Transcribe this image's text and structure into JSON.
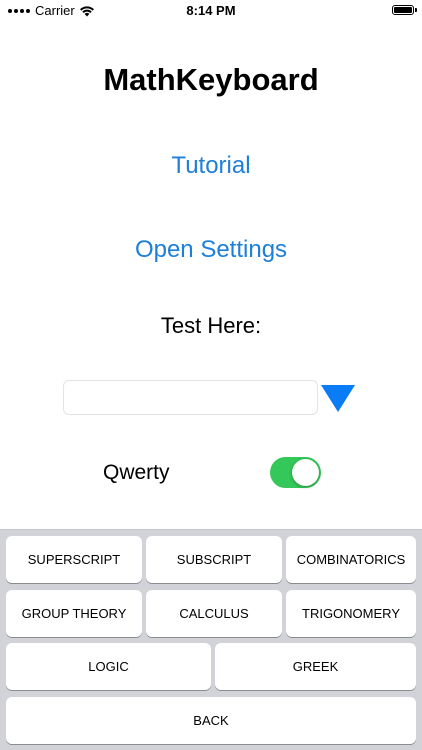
{
  "status_bar": {
    "carrier": "Carrier",
    "time": "8:14 PM",
    "battery_level": 1.0
  },
  "app": {
    "title": "MathKeyboard",
    "tutorial_label": "Tutorial",
    "open_settings_label": "Open Settings",
    "test_label": "Test Here:",
    "test_input_value": "",
    "qwerty_label": "Qwerty",
    "qwerty_enabled": true,
    "accent_color": "#1d7fd8",
    "toggle_color": "#34c759"
  },
  "keyboard": {
    "superscript": "SUPERSCRIPT",
    "subscript": "SUBSCRIPT",
    "combinatorics": "COMBINATORICS",
    "group_theory": "GROUP THEORY",
    "calculus": "CALCULUS",
    "trigonometry": "TRIGONOMERY",
    "logic": "LOGIC",
    "greek": "GREEK",
    "back": "BACK"
  },
  "icons": {
    "signal": "signal-dots-icon",
    "wifi": "wifi-icon",
    "battery": "battery-icon",
    "dropdown": "triangle-down-icon"
  }
}
